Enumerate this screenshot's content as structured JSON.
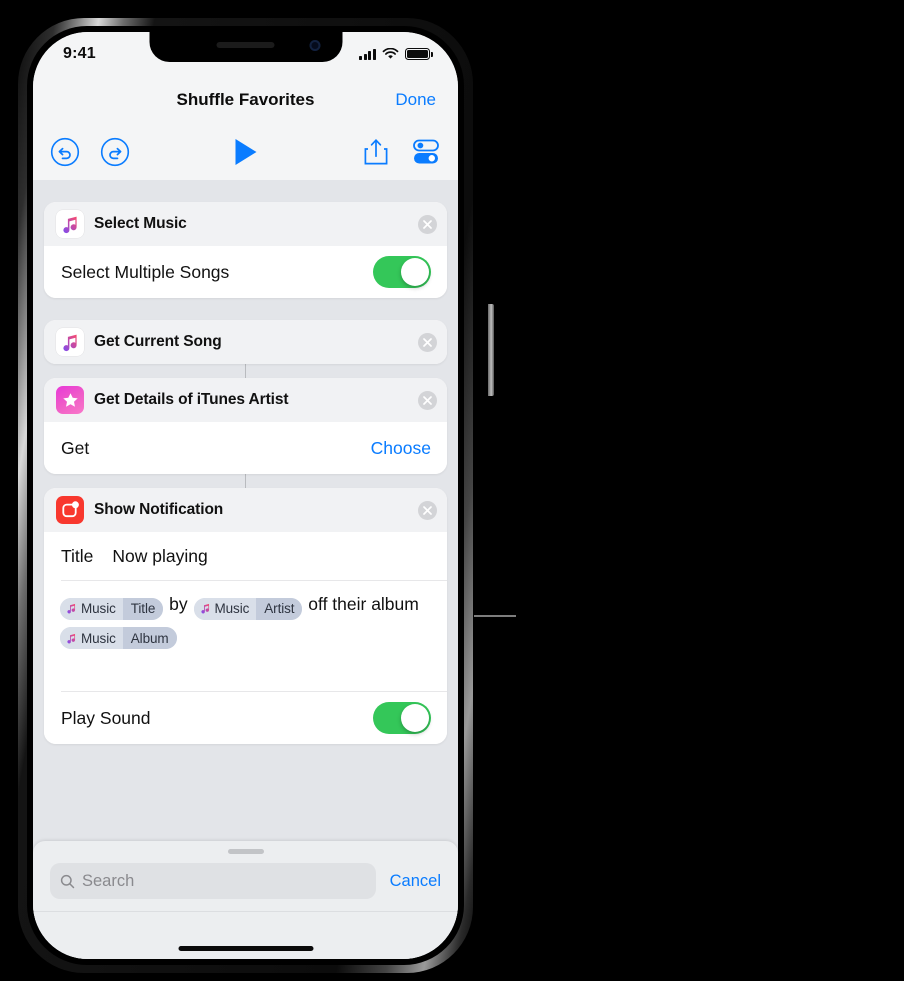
{
  "status_bar": {
    "time": "9:41",
    "signal_icon": "cellular-bars-icon",
    "wifi_icon": "wifi-icon",
    "battery_icon": "battery-icon"
  },
  "nav": {
    "title": "Shuffle Favorites",
    "done_label": "Done"
  },
  "toolbar": {
    "undo_icon": "undo-icon",
    "redo_icon": "redo-icon",
    "play_icon": "play-icon",
    "share_icon": "share-icon",
    "settings_icon": "settings-toggles-icon"
  },
  "actions": [
    {
      "title": "Select Music",
      "icon": "music-note-icon",
      "close_icon": "close-circle-icon",
      "rows": [
        {
          "label": "Select Multiple Songs",
          "control": "toggle",
          "value": "on"
        }
      ]
    },
    {
      "title": "Get Current Song",
      "icon": "music-note-icon",
      "close_icon": "close-circle-icon",
      "rows": []
    },
    {
      "title": "Get Details of iTunes Artist",
      "icon": "star-icon",
      "close_icon": "close-circle-icon",
      "rows": [
        {
          "label": "Get",
          "control": "link",
          "value": "Choose"
        }
      ]
    },
    {
      "title": "Show Notification",
      "icon": "notification-badge-icon",
      "close_icon": "close-circle-icon",
      "title_field": {
        "label": "Title",
        "value": "Now playing"
      },
      "message": {
        "segments": [
          {
            "type": "token",
            "source": "Music",
            "property": "Title"
          },
          {
            "type": "text",
            "text": " by "
          },
          {
            "type": "token",
            "source": "Music",
            "property": "Artist"
          },
          {
            "type": "text",
            "text": " off their album "
          },
          {
            "type": "token",
            "source": "Music",
            "property": "Album"
          }
        ],
        "text_1": "by",
        "text_2": "off their",
        "text_3": "album"
      },
      "rows": [
        {
          "label": "Play Sound",
          "control": "toggle",
          "value": "on"
        }
      ]
    }
  ],
  "token": {
    "source_label": "Music",
    "icon": "music-note-small-icon"
  },
  "sheet": {
    "grabber": "drag-handle",
    "search_placeholder": "Search",
    "search_value": "",
    "search_icon": "magnifier-icon",
    "cancel_label": "Cancel"
  },
  "callout": {
    "target": "Music Artist token",
    "line_color": "#7d7d7d"
  },
  "colors": {
    "accent_blue": "#0a7cff",
    "toggle_green": "#34c759",
    "notification_red": "#f8382e",
    "screen_bg": "#e3e5e9",
    "card_bg": "#ffffff"
  }
}
